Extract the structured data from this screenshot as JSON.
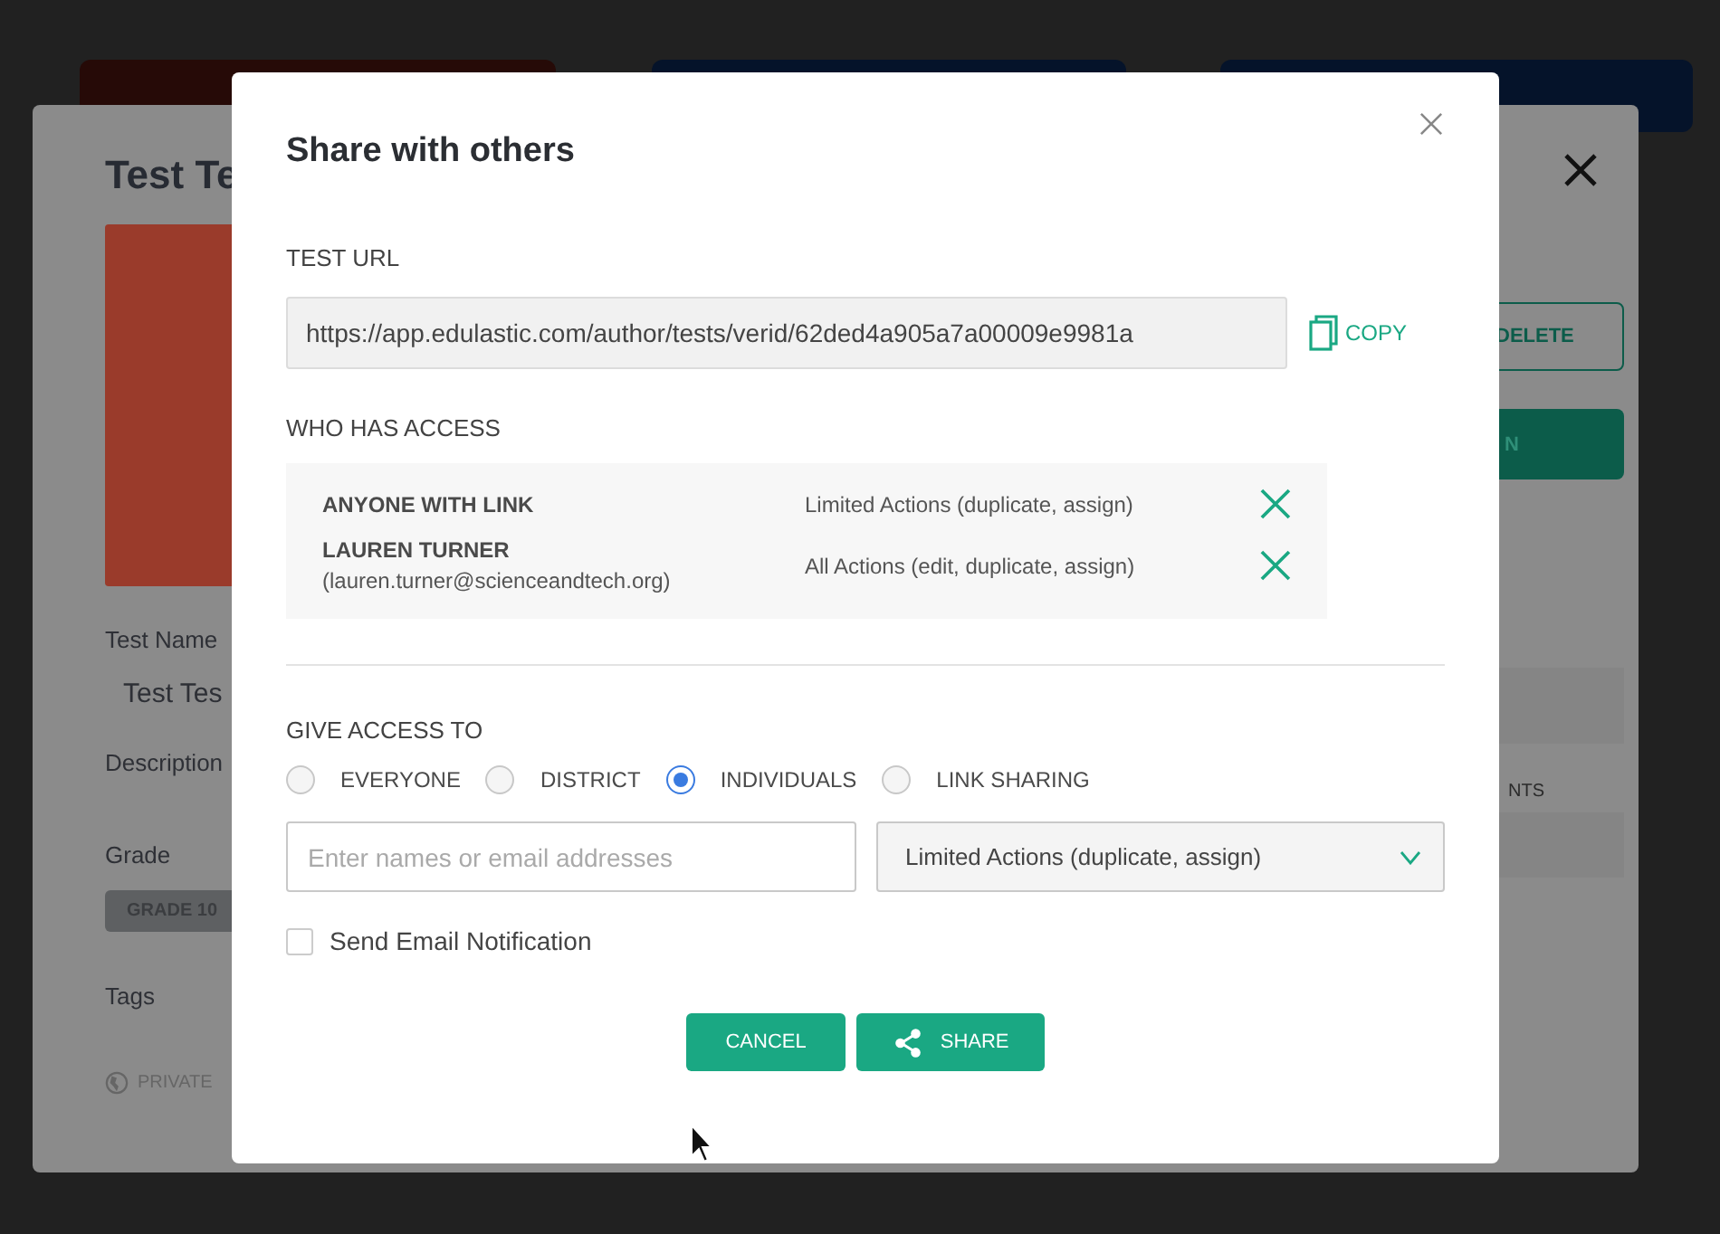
{
  "background": {
    "panel_title": "Test Te",
    "name_label": "Test Name",
    "name_value": "Test Tes",
    "description_label": "Description",
    "grade_label": "Grade",
    "grade_tag": "GRADE 10",
    "tags_label": "Tags",
    "visibility": "PRIVATE",
    "delete_button": "DELETE",
    "primary_button": "N",
    "section_label": "NTS"
  },
  "dialog": {
    "title": "Share with others",
    "url_label": "TEST URL",
    "url": "https://app.edulastic.com/author/tests/verid/62ded4a905a7a00009e9981a",
    "copy_label": "COPY",
    "access_label": "WHO HAS ACCESS",
    "access": [
      {
        "name": "ANYONE WITH LINK",
        "permission": "Limited Actions (duplicate, assign)"
      },
      {
        "name": "LAUREN TURNER",
        "email": "(lauren.turner@scienceandtech.org)",
        "permission": "All Actions (edit, duplicate, assign)"
      }
    ],
    "give_label": "GIVE ACCESS TO",
    "options": [
      {
        "label": "EVERYONE",
        "selected": false
      },
      {
        "label": "DISTRICT",
        "selected": false
      },
      {
        "label": "INDIVIDUALS",
        "selected": true
      },
      {
        "label": "LINK SHARING",
        "selected": false
      }
    ],
    "search": {
      "placeholder": "Enter names or email addresses"
    },
    "permission_select": "Limited Actions (duplicate, assign)",
    "notify": {
      "label": "Send Email Notification",
      "checked": false
    },
    "buttons": [
      {
        "label": "CANCEL",
        "kind": "plain"
      },
      {
        "label": "SHARE",
        "kind": "share"
      }
    ]
  }
}
